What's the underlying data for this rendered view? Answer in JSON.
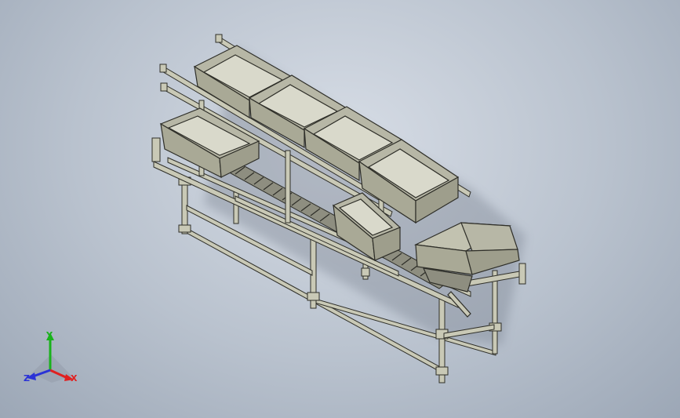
{
  "viewport": {
    "background_top": "#d7dde6",
    "background_bottom": "#9ca7b6"
  },
  "model": {
    "frame_color": "#c9c9b6",
    "frame_edge": "#2e2e28",
    "bin_outer": "#b7b7a6",
    "bin_inner": "#d9d9cb"
  },
  "triad": {
    "x_label": "X",
    "y_label": "Y",
    "z_label": "Z",
    "x_color": "#e02020",
    "y_color": "#19b21b",
    "z_color": "#2a32d6"
  }
}
